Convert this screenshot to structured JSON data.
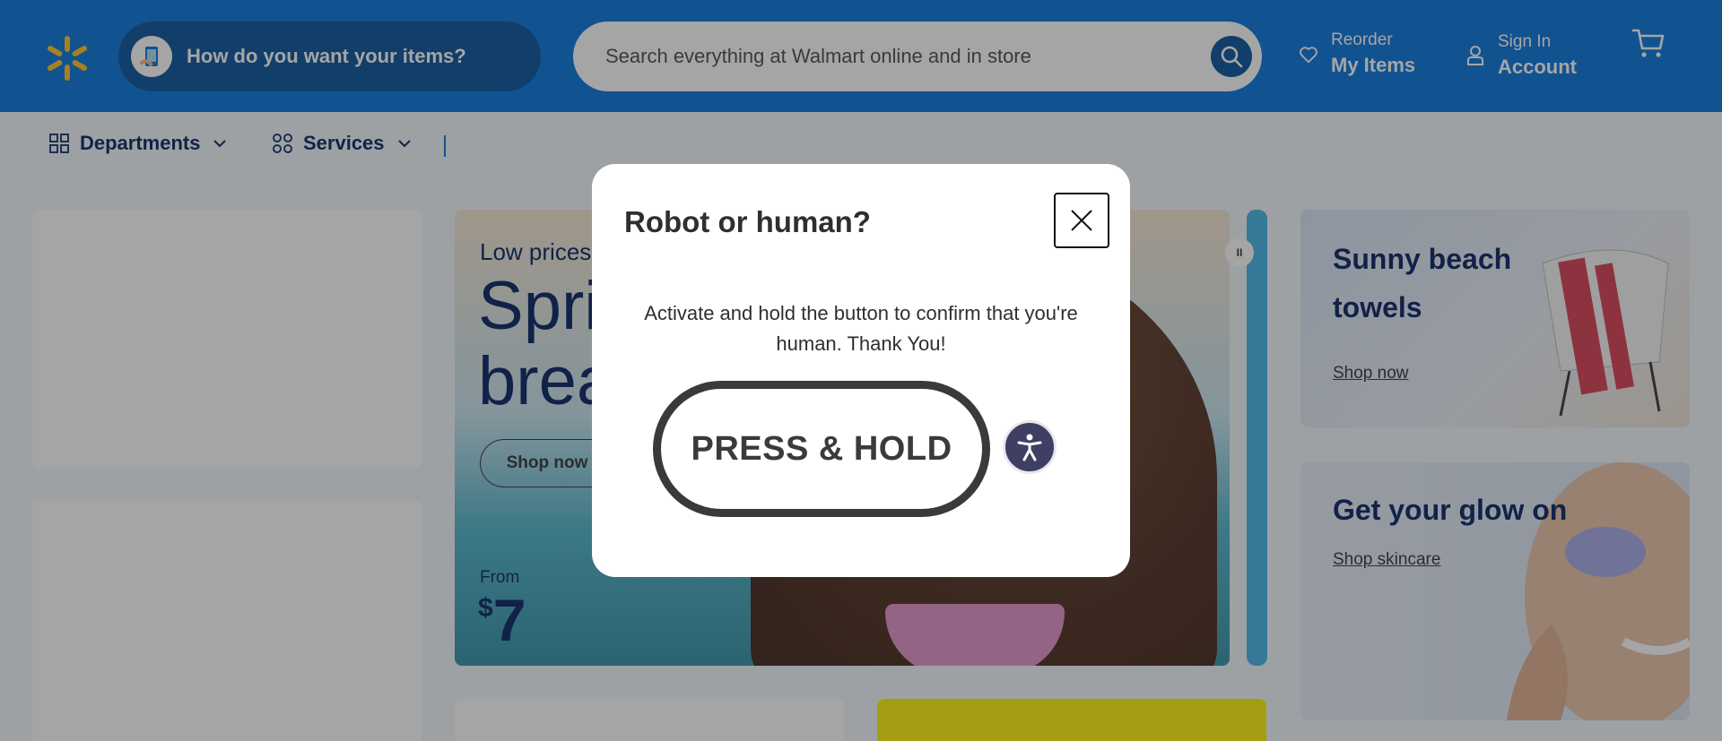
{
  "header": {
    "delivery_prompt": "How do you want your items?",
    "search": {
      "placeholder": "Search everything at Walmart online and in store"
    },
    "reorder": {
      "top": "Reorder",
      "bottom": "My Items"
    },
    "account": {
      "top": "Sign In",
      "bottom": "Account"
    },
    "colors": {
      "brand_blue": "#0071dc",
      "spark_yellow": "#ffc220"
    }
  },
  "nav": {
    "departments": "Departments",
    "services": "Services"
  },
  "hero": {
    "subtitle": "Low prices",
    "title_line1": "Spri",
    "title_line2": "brea",
    "shop_label": "Shop now",
    "from_label": "From",
    "price_symbol": "$",
    "price": "7"
  },
  "cards": {
    "towels": {
      "title_line1": "Sunny beach",
      "title_line2": "towels",
      "link": "Shop now"
    },
    "glow": {
      "title": "Get your glow on",
      "link": "Shop skincare"
    }
  },
  "modal": {
    "title": "Robot or human?",
    "message": "Activate and hold the button to confirm that you're human. Thank You!",
    "button_label": "PRESS & HOLD"
  }
}
